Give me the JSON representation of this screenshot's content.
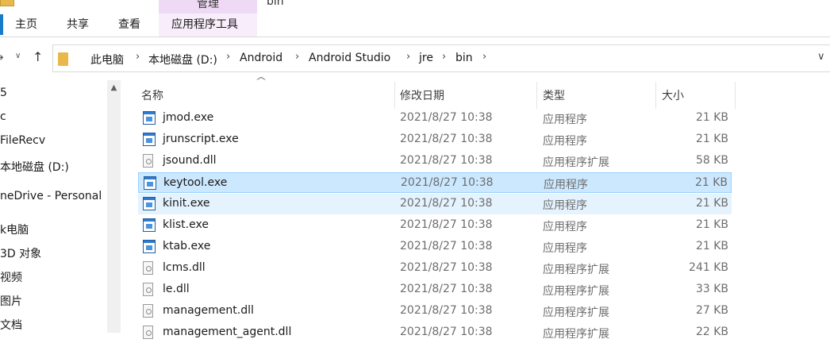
{
  "ribbon": {
    "quick_access_arrow": "▾",
    "tabs": {
      "home": "主页",
      "share": "共享",
      "view": "查看",
      "app_tools": "应用程序工具"
    },
    "contextual_header": "管理",
    "window_title": "bin"
  },
  "nav": {
    "back_icon": "←",
    "forward_icon": "→",
    "recent_icon": "∨",
    "up_icon": "↑"
  },
  "address": {
    "crumbs": [
      "此电脑",
      "本地磁盘 (D:)",
      "Android",
      "Android Studio",
      "jre",
      "bin"
    ],
    "separator": "›",
    "dropdown_icon": "∨"
  },
  "navpane": {
    "scroll_up_icon": "▲",
    "items": [
      "5",
      "c",
      "FileRecv",
      "本地磁盘 (D:)",
      "neDrive - Personal",
      "k电脑",
      "3D 对象",
      "视频",
      "图片",
      "文档"
    ]
  },
  "columns": {
    "name": "名称",
    "date": "修改日期",
    "type": "类型",
    "size": "大小",
    "sort_indicator": "^"
  },
  "files": [
    {
      "name": "jmod.exe",
      "date": "2021/8/27 10:38",
      "type": "应用程序",
      "size": "21 KB",
      "kind": "exe"
    },
    {
      "name": "jrunscript.exe",
      "date": "2021/8/27 10:38",
      "type": "应用程序",
      "size": "21 KB",
      "kind": "exe"
    },
    {
      "name": "jsound.dll",
      "date": "2021/8/27 10:38",
      "type": "应用程序扩展",
      "size": "58 KB",
      "kind": "dll"
    },
    {
      "name": "keytool.exe",
      "date": "2021/8/27 10:38",
      "type": "应用程序",
      "size": "21 KB",
      "kind": "exe"
    },
    {
      "name": "kinit.exe",
      "date": "2021/8/27 10:38",
      "type": "应用程序",
      "size": "21 KB",
      "kind": "exe"
    },
    {
      "name": "klist.exe",
      "date": "2021/8/27 10:38",
      "type": "应用程序",
      "size": "21 KB",
      "kind": "exe"
    },
    {
      "name": "ktab.exe",
      "date": "2021/8/27 10:38",
      "type": "应用程序",
      "size": "21 KB",
      "kind": "exe"
    },
    {
      "name": "lcms.dll",
      "date": "2021/8/27 10:38",
      "type": "应用程序扩展",
      "size": "241 KB",
      "kind": "dll"
    },
    {
      "name": "le.dll",
      "date": "2021/8/27 10:38",
      "type": "应用程序扩展",
      "size": "33 KB",
      "kind": "dll"
    },
    {
      "name": "management.dll",
      "date": "2021/8/27 10:38",
      "type": "应用程序扩展",
      "size": "27 KB",
      "kind": "dll"
    },
    {
      "name": "management_agent.dll",
      "date": "2021/8/27 10:38",
      "type": "应用程序扩展",
      "size": "22 KB",
      "kind": "dll"
    }
  ],
  "selection": {
    "selected": "keytool.exe",
    "hovered": "kinit.exe"
  },
  "colors": {
    "selected_bg": "#cce8ff",
    "selected_border": "#99d1ff",
    "hover_bg": "#e5f3ff",
    "manage_tab": "#efdaf5",
    "accent": "#1979ca"
  }
}
